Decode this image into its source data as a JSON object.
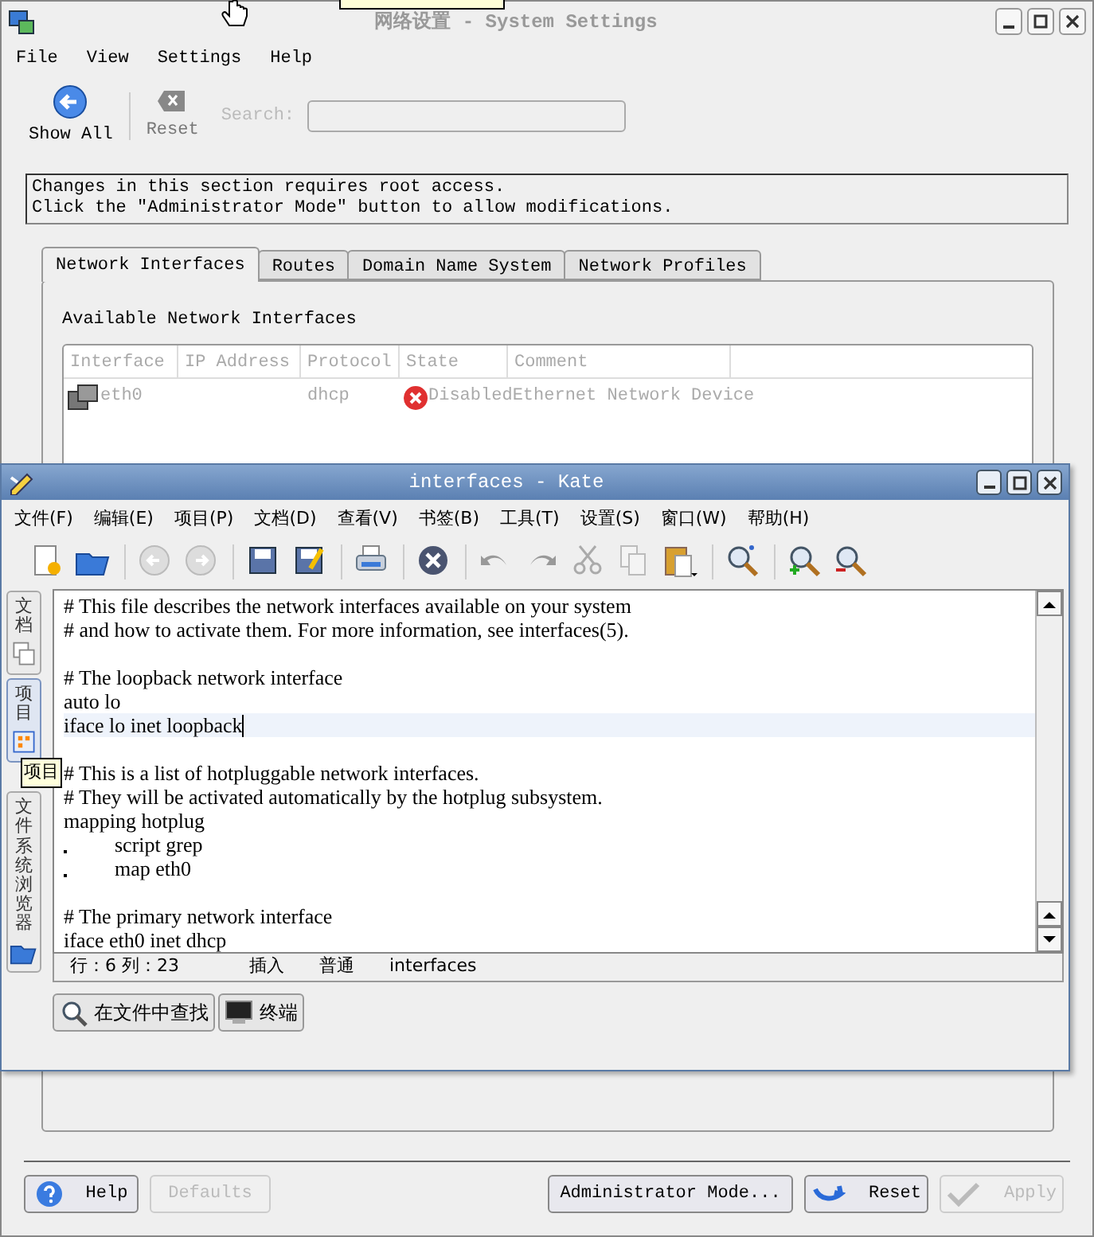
{
  "settings_window": {
    "title": "网络设置 - System Settings",
    "active": false,
    "menu": [
      "File",
      "View",
      "Settings",
      "Help"
    ],
    "toolbar": [
      {
        "label": "Show All",
        "disabled": false
      },
      {
        "label": "Reset",
        "disabled": true
      }
    ],
    "search": {
      "label": "Search:",
      "disabled": true
    },
    "notice": [
      "Changes in this section requires root access.",
      "Click the \"Administrator Mode\" button to allow modifications."
    ],
    "tabs": [
      {
        "label": "Network Interfaces",
        "selected": true
      },
      {
        "label": "Routes",
        "selected": false
      },
      {
        "label": "Domain Name System",
        "selected": false
      },
      {
        "label": "Network Profiles",
        "selected": false
      }
    ],
    "section_title": "Available Network Interfaces",
    "table": {
      "disabled": true,
      "columns": [
        "Interface",
        "IP Address",
        "Protocol",
        "State",
        "Comment"
      ],
      "rows": [
        {
          "interface": "eth0",
          "protocol": "dhcp",
          "state": "Disabled",
          "comment": "Ethernet Network Device"
        }
      ]
    },
    "buttons_left": [
      {
        "label": "Help",
        "disabled": false
      },
      {
        "label": "Defaults",
        "disabled": true
      }
    ],
    "buttons_right": [
      {
        "label": "Administrator Mode...",
        "disabled": false
      },
      {
        "label": "Reset",
        "disabled": false
      },
      {
        "label": "Apply",
        "disabled": true
      }
    ]
  },
  "kate_window": {
    "title": "interfaces - Kate",
    "active": true,
    "menu": [
      "文件(F)",
      "编辑(E)",
      "项目(P)",
      "文档(D)",
      "查看(V)",
      "书签(B)",
      "工具(T)",
      "设置(S)",
      "窗口(W)",
      "帮助(H)"
    ],
    "side_tabs": [
      {
        "label": "文档",
        "selected": false
      },
      {
        "label": "项目",
        "selected": true
      },
      {
        "label": "文件系统浏览器",
        "selected": false
      }
    ],
    "tooltip": "项目",
    "lines": [
      {
        "text": "# This file describes the network interfaces available on your system",
        "indented": false,
        "current": false
      },
      {
        "text": "# and how to activate them. For more information, see interfaces(5).",
        "indented": false,
        "current": false
      },
      {
        "indented": false,
        "current": false
      },
      {
        "text": "# The loopback network interface",
        "indented": false,
        "current": false
      },
      {
        "text": "auto lo",
        "indented": false,
        "current": false
      },
      {
        "text": "iface lo inet loopback",
        "indented": false,
        "current": true
      },
      {
        "indented": false,
        "current": false
      },
      {
        "text": "# This is a list of hotpluggable network interfaces.",
        "indented": false,
        "current": false
      },
      {
        "text": "# They will be activated automatically by the hotplug subsystem.",
        "indented": false,
        "current": false
      },
      {
        "text": "mapping hotplug",
        "indented": false,
        "current": false
      },
      {
        "text": "script grep",
        "indented": true,
        "current": false
      },
      {
        "text": "map eth0",
        "indented": true,
        "current": false
      },
      {
        "indented": false,
        "current": false
      },
      {
        "text": "# The primary network interface",
        "indented": false,
        "current": false
      },
      {
        "text": "iface eth0 inet dhcp",
        "indented": false,
        "current": false
      }
    ],
    "status": [
      "行：6 列：23",
      "插入",
      "普通",
      "interfaces"
    ],
    "tool_views": [
      "在文件中查找",
      "终端"
    ]
  }
}
